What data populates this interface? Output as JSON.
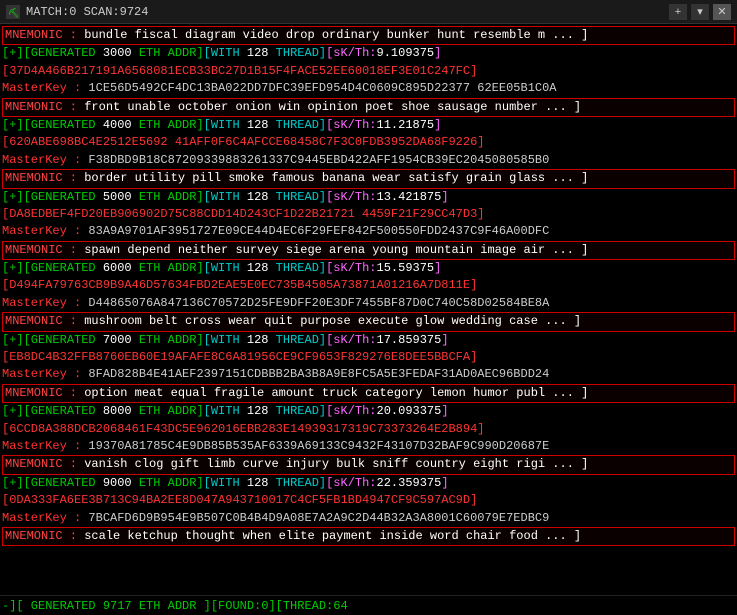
{
  "titleBar": {
    "icon": "app-icon",
    "title": "MATCH:0 SCAN:9724",
    "addTab": "+",
    "dropdownBtn": "▾",
    "closeBtn": "✕"
  },
  "statusBar": {
    "text": "-][ GENERATED 9717 ETH ADDR ][FOUND:0][THREAD:64"
  },
  "lines": [
    {
      "type": "mnemonic",
      "text": "MNEMONIC : bundle fiscal diagram video drop ordinary bunker hunt resemble m ... ]"
    },
    {
      "type": "generated",
      "text": "[+][GENERATED 3000 ETH ADDR][WITH 128 THREAD][sK/Th:9.109375]"
    },
    {
      "type": "address",
      "text": "[37D4A466B217191A6568081ECB33BC27D1B15F4FACE52EE60018EF3E01C247FC]"
    },
    {
      "type": "masterkey",
      "text": "MasterKey : 1CE56D5492CF4DC13BA022DD7DFC39EFD954D4C0609C895D22377 62EE05B1C0A"
    },
    {
      "type": "mnemonic",
      "text": "MNEMONIC : front unable october onion win opinion poet shoe sausage number ... ]"
    },
    {
      "type": "generated",
      "text": "[+][GENERATED 4000 ETH ADDR][WITH 128 THREAD][sK/Th:11.21875]"
    },
    {
      "type": "address",
      "text": "[620ABE698BC4E2512E5692 41AFF0F6C4AFCCE68458C7F3C0FDB3952DA68F9226]"
    },
    {
      "type": "masterkey",
      "text": "MasterKey : F38DBD9B18C87209339883261337C9445EBD422AFF1954CB39EC2045080585B0"
    },
    {
      "type": "mnemonic",
      "text": "MNEMONIC : border utility pill smoke famous banana wear satisfy grain glass ... ]"
    },
    {
      "type": "generated",
      "text": "[+][GENERATED 5000 ETH ADDR][WITH 128 THREAD][sK/Th:13.421875]"
    },
    {
      "type": "address",
      "text": "[DA8EDBEF4FD20EB906902D75C88CDD14D243CF1D22B21721 4459F21F29CC47D3]"
    },
    {
      "type": "masterkey",
      "text": "MasterKey : 83A9A9701AF3951727E09CE44D4EC6F29FEF842F500550FDD2437C9F46A00DFC"
    },
    {
      "type": "mnemonic",
      "text": "MNEMONIC : spawn depend neither survey siege arena young mountain image air ... ]"
    },
    {
      "type": "generated",
      "text": "[+][GENERATED 6000 ETH ADDR][WITH 128 THREAD][sK/Th:15.59375]"
    },
    {
      "type": "address",
      "text": "[D494FA79763CB9B9A46D57634FBD2EAE5E0EC735B4505A73871A01216A7D811E]"
    },
    {
      "type": "masterkey",
      "text": "MasterKey : D44865076A847136C70572D25FE9DFF20E3DF7455BF87D0C740C58D02584BE8A"
    },
    {
      "type": "mnemonic",
      "text": "MNEMONIC : mushroom belt cross wear quit purpose execute glow wedding case ... ]"
    },
    {
      "type": "generated",
      "text": "[+][GENERATED 7000 ETH ADDR][WITH 128 THREAD][sK/Th:17.859375]"
    },
    {
      "type": "address",
      "text": "[EB8DC4B32FFB8760EB60E19AFAFE8C6A81956CE9CF9653F829276E8DEE5BBCFA]"
    },
    {
      "type": "masterkey",
      "text": "MasterKey : 8FAD828B4E41AEF2397151CDBBB2BA3B8A9E8FC5A5E3FEDAF31AD0AEC96BDD24"
    },
    {
      "type": "mnemonic",
      "text": "MNEMONIC : option meat equal fragile amount truck category lemon humor publ ... ]"
    },
    {
      "type": "generated",
      "text": "[+][GENERATED 8000 ETH ADDR][WITH 128 THREAD][sK/Th:20.093375]"
    },
    {
      "type": "address",
      "text": "[6CCD8A388DCB2068461F43DC5E962016EBB283E14939317319C73373264E2B894]"
    },
    {
      "type": "masterkey",
      "text": "MasterKey : 19370A81785C4E9DB85B535AF6339A69133C9432F43107D32BAF9C990D20687E"
    },
    {
      "type": "mnemonic",
      "text": "MNEMONIC : vanish clog gift limb curve injury bulk sniff country eight rigi ... ]"
    },
    {
      "type": "generated",
      "text": "[+][GENERATED 9000 ETH ADDR][WITH 128 THREAD][sK/Th:22.359375]"
    },
    {
      "type": "address",
      "text": "[0DA333FA6EE3B713C94BA2EE8D047A943710017C4CF5FB1BD4947CF9C597AC9D]"
    },
    {
      "type": "masterkey",
      "text": "MasterKey : 7BCAFD6D9B954E9B507C0B4B4D9A08E7A2A9C2D44B32A3A8001C60079E7EDBC9"
    },
    {
      "type": "mnemonic",
      "text": "MNEMONIC : scale ketchup thought when elite payment inside word chair food ... ]"
    }
  ]
}
